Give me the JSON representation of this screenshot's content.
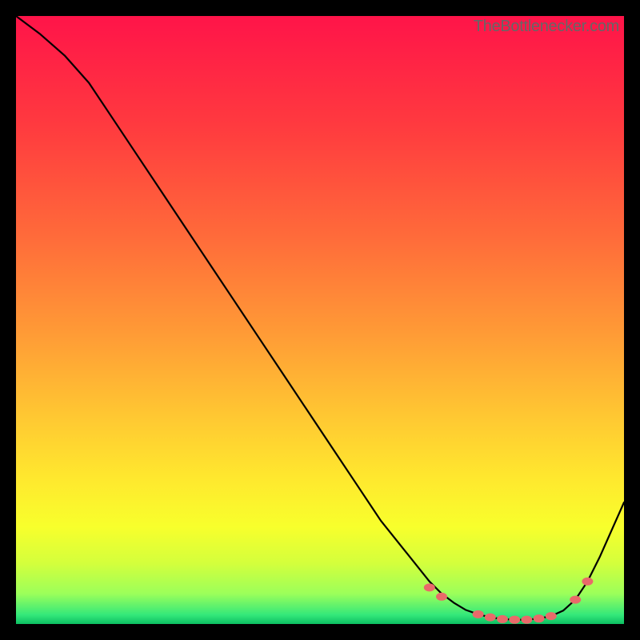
{
  "watermark": "TheBottlenecker.com",
  "chart_data": {
    "type": "line",
    "title": "",
    "xlabel": "",
    "ylabel": "",
    "xlim": [
      0,
      100
    ],
    "ylim": [
      0,
      100
    ],
    "x": [
      0,
      4,
      8,
      12,
      16,
      20,
      24,
      28,
      32,
      36,
      40,
      44,
      48,
      52,
      56,
      60,
      64,
      68,
      70,
      72,
      74,
      76,
      78,
      80,
      82,
      84,
      86,
      88,
      90,
      92,
      94,
      96,
      98,
      100
    ],
    "y": [
      100,
      97,
      93.5,
      89,
      83,
      77,
      71,
      65,
      59,
      53,
      47,
      41,
      35,
      29,
      23,
      17,
      12,
      7,
      5,
      3.5,
      2.3,
      1.6,
      1.1,
      0.8,
      0.7,
      0.7,
      0.9,
      1.3,
      2.2,
      4.0,
      7.0,
      11,
      15.5,
      20
    ],
    "marker_points_x": [
      68,
      70,
      76,
      78,
      80,
      82,
      84,
      86,
      88,
      92,
      94
    ],
    "marker_points_y": [
      6.0,
      4.5,
      1.6,
      1.1,
      0.8,
      0.7,
      0.7,
      0.9,
      1.3,
      4.0,
      7.0
    ],
    "gradient_stops": [
      {
        "offset": 0.0,
        "color": "#ff1449"
      },
      {
        "offset": 0.18,
        "color": "#ff3a3f"
      },
      {
        "offset": 0.36,
        "color": "#ff6a3a"
      },
      {
        "offset": 0.52,
        "color": "#ff9a36"
      },
      {
        "offset": 0.66,
        "color": "#ffc832"
      },
      {
        "offset": 0.76,
        "color": "#ffe82e"
      },
      {
        "offset": 0.84,
        "color": "#f8ff2c"
      },
      {
        "offset": 0.9,
        "color": "#d4ff3c"
      },
      {
        "offset": 0.95,
        "color": "#9cff5a"
      },
      {
        "offset": 0.985,
        "color": "#34e87a"
      },
      {
        "offset": 1.0,
        "color": "#0cbf62"
      }
    ],
    "marker_color": "#e96a6a",
    "marker_rx": 7,
    "marker_ry": 5
  }
}
